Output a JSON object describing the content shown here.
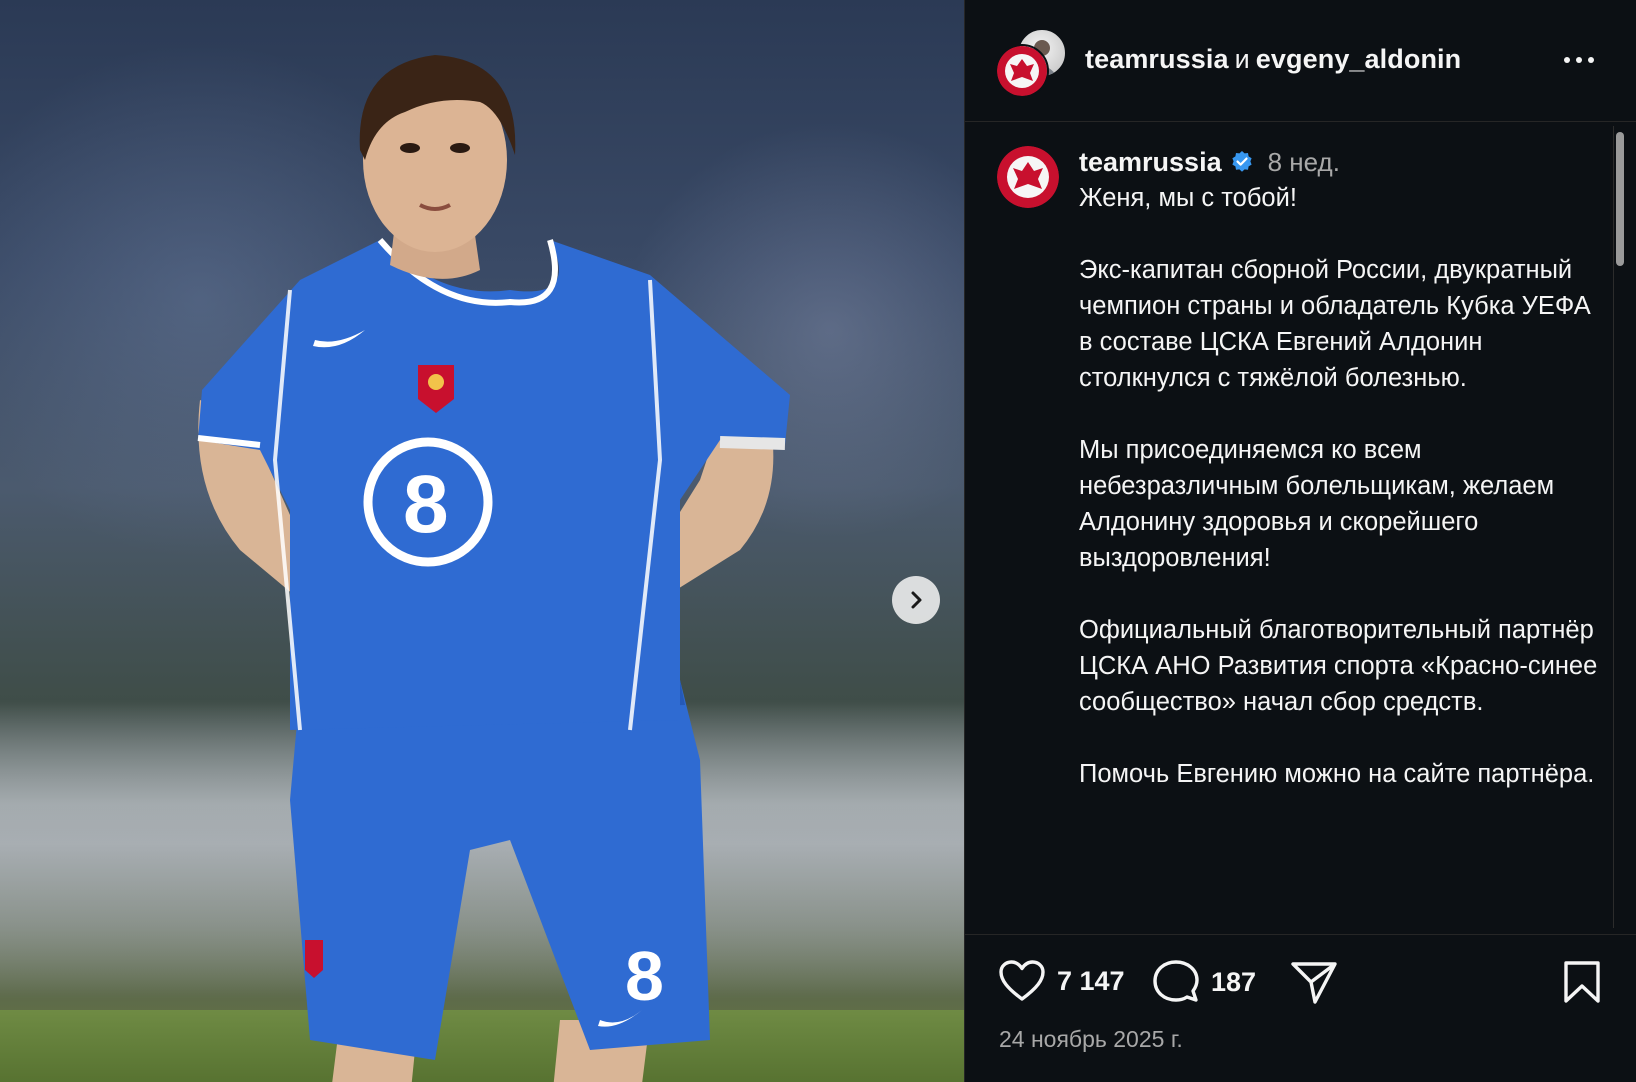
{
  "post_header": {
    "author_primary": "teamrussia",
    "conjunction": "и",
    "author_secondary": "evgeny_aldonin",
    "more_icon": "more-horizontal-icon"
  },
  "media": {
    "jersey_number": "8",
    "next_icon": "chevron-right-icon"
  },
  "caption": {
    "username": "teamrussia",
    "verified_icon": "verified-badge-icon",
    "time": "8 нед.",
    "paragraphs": [
      "Женя, мы с тобой!",
      "Экс-капитан сборной России, двукратный чемпион страны и обладатель Кубка УЕФА в составе ЦСКА Евгений Алдонин столкнулся с тяжёлой болезнью.",
      "Мы присоединяемся ко всем небезразличным болельщикам, желаем Алдонину здоровья и скорейшего выздоровления!",
      "Официальный благотворительный партнёр ЦСКА АНО Развития спорта «Красно-синее сообщество» начал сбор средств.",
      "Помочь Евгению можно на сайте партнёра."
    ]
  },
  "actions": {
    "likes": "7 147",
    "comments": "187",
    "like_icon": "heart-icon",
    "comment_icon": "comment-icon",
    "share_icon": "share-icon",
    "save_icon": "bookmark-icon"
  },
  "date": "24 ноябрь 2025 г.",
  "colors": {
    "background": "#0c1014",
    "text": "#f5f5f5",
    "muted": "#a8a8a8",
    "verified": "#3797f0",
    "jersey": "#2f6bd2"
  }
}
